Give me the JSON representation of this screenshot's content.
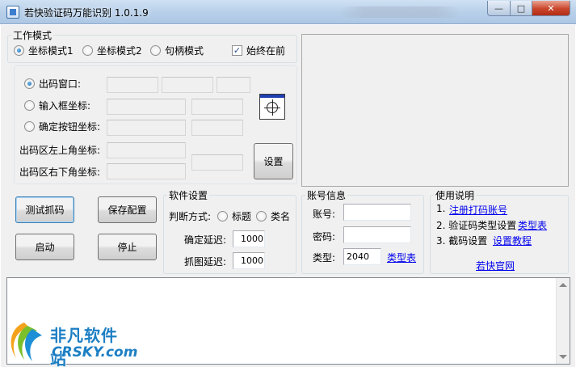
{
  "window": {
    "title": "若快验证码万能识别 1.0.1.9",
    "min_glyph": "—",
    "max_glyph": "□",
    "close_glyph": "✕"
  },
  "work_mode": {
    "legend": "工作模式",
    "options": [
      "坐标模式1",
      "坐标模式2",
      "句柄模式"
    ],
    "selected": 0,
    "always_on_top_label": "始终在前",
    "always_on_top": true
  },
  "targets": {
    "code_window_label": "出码窗口:",
    "input_coord_label": "输入框坐标:",
    "confirm_coord_label": "确定按钮坐标:",
    "area_topleft_label": "出码区左上角坐标:",
    "area_bottomright_label": "出码区右下角坐标:",
    "selected": "code_window",
    "set_button": "设置"
  },
  "buttons": {
    "test_capture": "测试抓码",
    "save_config": "保存配置",
    "start": "启动",
    "stop": "停止"
  },
  "software_settings": {
    "legend": "软件设置",
    "judge_label": "判断方式:",
    "judge_options": [
      "标题",
      "类名"
    ],
    "judge_selected": -1,
    "confirm_delay_label": "确定延迟:",
    "confirm_delay": "1000",
    "capture_delay_label": "抓图延迟:",
    "capture_delay": "1000"
  },
  "account": {
    "legend": "账号信息",
    "user_label": "账号:",
    "user_value": "",
    "pass_label": "密码:",
    "pass_value": "",
    "type_label": "类型:",
    "type_value": "2040",
    "type_link": "类型表"
  },
  "usage": {
    "legend": "使用说明",
    "step1_prefix": "1.",
    "step1_link": "注册打码账号",
    "step2_prefix": "2. 验证码类型设置",
    "step2_link": "类型表",
    "step3_prefix": "3. 截码设置",
    "step3_link": "设置教程",
    "website_link": "若快官网"
  },
  "watermark": {
    "cn": "非凡软件站",
    "en": "CRSKY.com"
  },
  "colors": {
    "link": "#0000ee",
    "watermark": "#1d7fc4"
  }
}
